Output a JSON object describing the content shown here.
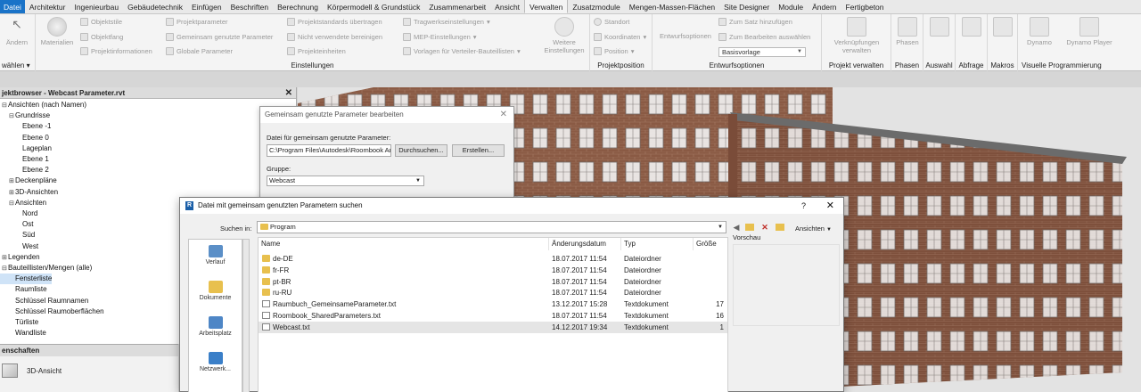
{
  "tabs": [
    "Datei",
    "Architektur",
    "Ingenieurbau",
    "Gebäudetechnik",
    "Einfügen",
    "Beschriften",
    "Berechnung",
    "Körpermodell & Grundstück",
    "Zusammenarbeit",
    "Ansicht",
    "Verwalten",
    "Zusatzmodule",
    "Mengen-Massen-Flächen",
    "Site Designer",
    "Module",
    "Ändern",
    "Fertigbeton"
  ],
  "active_tab": "Verwalten",
  "ribbon": {
    "first": {
      "aendern": "Ändern",
      "auswaehlen": "wählen"
    },
    "materialien": "Materialien",
    "objektstile": "Objektstile",
    "objektfang": "Objektfang",
    "projektinformationen": "Projektinformationen",
    "projektparameter": "Projektparameter",
    "gemeinsam": "Gemeinsam genutzte Parameter",
    "globale": "Globale Parameter",
    "standards": "Projektstandards übertragen",
    "nicht_verwendet": "Nicht verwendete bereinigen",
    "projekteinheiten": "Projekteinheiten",
    "tragwerk": "Tragwerkseinstellungen",
    "mep": "MEP-Einstellungen",
    "vorlagen": "Vorlagen für Verteiler-Bauteillisten",
    "weitere": "Weitere Einstellungen",
    "einstellungen": "Einstellungen",
    "standort": "Standort",
    "koordinaten": "Koordinaten",
    "position": "Position",
    "projektposition": "Projektposition",
    "entwurfsoptionen_btn": "Entwurfsoptionen",
    "zum_satz": "Zum Satz hinzufügen",
    "zum_bearbeiten": "Zum Bearbeiten auswählen",
    "basisvorlage": "Basisvorlage",
    "entwurfsoptionen": "Entwurfsoptionen",
    "verknuepfungen": "Verknüpfungen verwalten",
    "projekt_verwalten": "Projekt verwalten",
    "phasen_btn": "Phasen",
    "phasen": "Phasen",
    "auswahl": "Auswahl",
    "abfrage": "Abfrage",
    "makros": "Makros",
    "dynamo": "Dynamo",
    "dynamo_player": "Dynamo Player",
    "visuelle": "Visuelle Programmierung"
  },
  "project_browser": {
    "title": "jektbrowser - Webcast Parameter.rvt",
    "nodes": [
      {
        "label": "Ansichten (nach Namen)",
        "indent": 0,
        "toggle": "⊟"
      },
      {
        "label": "Grundrisse",
        "indent": 1,
        "toggle": "⊟"
      },
      {
        "label": "Ebene -1",
        "indent": 2,
        "toggle": ""
      },
      {
        "label": "Ebene 0",
        "indent": 2,
        "toggle": ""
      },
      {
        "label": "Lageplan",
        "indent": 2,
        "toggle": ""
      },
      {
        "label": "Ebene 1",
        "indent": 2,
        "toggle": ""
      },
      {
        "label": "Ebene 2",
        "indent": 2,
        "toggle": ""
      },
      {
        "label": "Deckenpläne",
        "indent": 1,
        "toggle": "⊞"
      },
      {
        "label": "3D-Ansichten",
        "indent": 1,
        "toggle": "⊞"
      },
      {
        "label": "Ansichten",
        "indent": 1,
        "toggle": "⊟"
      },
      {
        "label": "Nord",
        "indent": 2,
        "toggle": ""
      },
      {
        "label": "Ost",
        "indent": 2,
        "toggle": ""
      },
      {
        "label": "Süd",
        "indent": 2,
        "toggle": ""
      },
      {
        "label": "West",
        "indent": 2,
        "toggle": ""
      },
      {
        "label": "Legenden",
        "indent": 0,
        "toggle": "⊞"
      },
      {
        "label": "Bauteillisten/Mengen (alle)",
        "indent": 0,
        "toggle": "⊟"
      },
      {
        "label": "Fensterliste",
        "indent": 1,
        "toggle": "",
        "selected": true
      },
      {
        "label": "Raumliste",
        "indent": 1,
        "toggle": ""
      },
      {
        "label": "Schlüssel Raumnamen",
        "indent": 1,
        "toggle": ""
      },
      {
        "label": "Schlüssel Raumoberflächen",
        "indent": 1,
        "toggle": ""
      },
      {
        "label": "Türliste",
        "indent": 1,
        "toggle": ""
      },
      {
        "label": "Wandliste",
        "indent": 1,
        "toggle": ""
      }
    ]
  },
  "properties": {
    "title": "enschaften",
    "type": "3D-Ansicht"
  },
  "dialog_params": {
    "title": "Gemeinsam genutzte Parameter bearbeiten",
    "file_label": "Datei für gemeinsam genutzte Parameter:",
    "file_value": "C:\\Program Files\\Autodesk\\Roombook An",
    "browse": "Durchsuchen...",
    "create": "Erstellen...",
    "group_label": "Gruppe:",
    "group_value": "Webcast"
  },
  "dialog_file": {
    "title": "Datei mit gemeinsam genutzten Parametern suchen",
    "help": "?",
    "look_in_label": "Suchen in:",
    "look_in_value": "Program",
    "views_label": "Ansichten",
    "preview_label": "Vorschau",
    "places": [
      "Verlauf",
      "Dokumente",
      "Arbeitsplatz",
      "Netzwerk..."
    ],
    "columns": [
      "Name",
      "Änderungsdatum",
      "Typ",
      "Größe"
    ],
    "rows": [
      {
        "name": "de-DE",
        "date": "18.07.2017 11:54",
        "type": "Dateiordner",
        "size": "",
        "kind": "folder"
      },
      {
        "name": "fr-FR",
        "date": "18.07.2017 11:54",
        "type": "Dateiordner",
        "size": "",
        "kind": "folder"
      },
      {
        "name": "pt-BR",
        "date": "18.07.2017 11:54",
        "type": "Dateiordner",
        "size": "",
        "kind": "folder"
      },
      {
        "name": "ru-RU",
        "date": "18.07.2017 11:54",
        "type": "Dateiordner",
        "size": "",
        "kind": "folder"
      },
      {
        "name": "Raumbuch_GemeinsameParameter.txt",
        "date": "13.12.2017 15:28",
        "type": "Textdokument",
        "size": "17",
        "kind": "doc"
      },
      {
        "name": "Roombook_SharedParameters.txt",
        "date": "18.07.2017 11:54",
        "type": "Textdokument",
        "size": "16",
        "kind": "doc"
      },
      {
        "name": "Webcast.txt",
        "date": "14.12.2017 19:34",
        "type": "Textdokument",
        "size": "1",
        "kind": "doc",
        "selected": true
      }
    ]
  },
  "colors": {
    "accent": "#1a73c8",
    "brick": "#8a5a44",
    "selection": "#cfe3f7"
  }
}
